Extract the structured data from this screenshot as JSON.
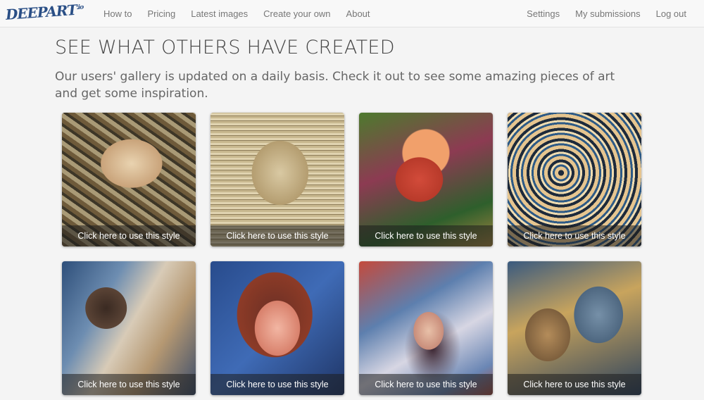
{
  "logo": {
    "text": "DEEPART",
    "sub": ".io"
  },
  "nav": {
    "left": [
      "How to",
      "Pricing",
      "Latest images",
      "Create your own",
      "About"
    ],
    "right": [
      "Settings",
      "My submissions",
      "Log out"
    ]
  },
  "header": {
    "title": "SEE WHAT OTHERS HAVE CREATED",
    "subtitle": "Our users' gallery is updated on a daily basis. Check it out to see some amazing pieces of art and get some inspiration."
  },
  "gallery": {
    "caption": "Click here to use this style",
    "items": [
      {
        "caption": "Click here to use this style"
      },
      {
        "caption": "Click here to use this style"
      },
      {
        "caption": "Click here to use this style"
      },
      {
        "caption": "Click here to use this style"
      },
      {
        "caption": "Click here to use this style"
      },
      {
        "caption": "Click here to use this style"
      },
      {
        "caption": "Click here to use this style"
      },
      {
        "caption": "Click here to use this style"
      }
    ]
  }
}
